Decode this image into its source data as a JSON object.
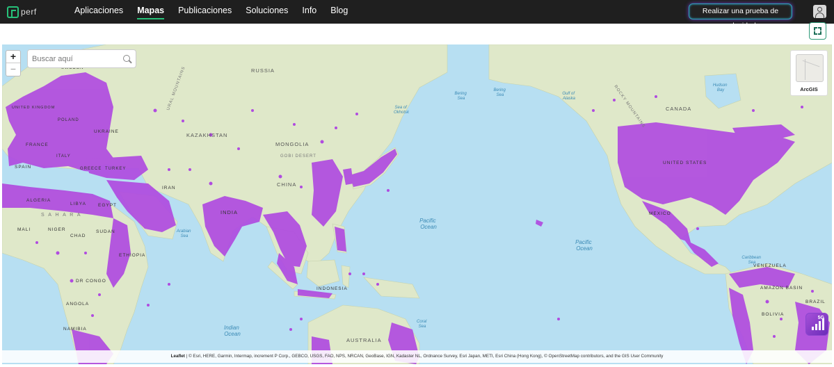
{
  "header": {
    "logo_text": "perf",
    "nav": [
      {
        "label": "Aplicaciones",
        "active": false
      },
      {
        "label": "Mapas",
        "active": true
      },
      {
        "label": "Publicaciones",
        "active": false
      },
      {
        "label": "Soluciones",
        "active": false
      },
      {
        "label": "Info",
        "active": false
      },
      {
        "label": "Blog",
        "active": false
      }
    ],
    "speed_test_label": "Realizar una prueba de velocidad",
    "user_icon": "user-icon",
    "accent_color": "#27c27a"
  },
  "map": {
    "zoom_in": "+",
    "zoom_out": "−",
    "search_placeholder": "Buscar aquí",
    "basemap_label": "ArcGIS",
    "badge_label": "5G",
    "coverage_color": "#b04be0",
    "ocean_color": "#b7dff2",
    "labels": {
      "russia": "RUSSIA",
      "kazakhstan": "KAZAKHSTAN",
      "mongolia": "MONGOLIA",
      "gobi": "GOBI DESERT",
      "china": "CHINA",
      "india": "INDIA",
      "ukraine": "UKRAINE",
      "poland": "POLAND",
      "france": "FRANCE",
      "spain": "SPAIN",
      "italy": "ITALY",
      "greece": "GREECE",
      "turkey": "TURKEY",
      "iran": "IRAN",
      "algeria": "ALGERIA",
      "libya": "LIBYA",
      "egypt": "EGYPT",
      "sahara": "S A H A R A",
      "mali": "MALI",
      "niger": "NIGER",
      "chad": "CHAD",
      "sudan": "SUDAN",
      "ethiopia": "ETHIOPIA",
      "drcongo": "DR CONGO",
      "angola": "ANGOLA",
      "namibia": "NAMIBIA",
      "indonesia": "INDONESIA",
      "australia": "AUSTRALIA",
      "canada": "CANADA",
      "united_states": "UNITED STATES",
      "mexico": "MEXICO",
      "venezuela": "VENEZUELA",
      "amazon": "AMAZON BASIN",
      "bolivia": "BOLIVIA",
      "brazil": "BRAZIL",
      "pacific_ocean": "Pacific\nOcean",
      "indian_ocean": "Indian\nOcean",
      "arabian_sea": "Arabian\nSea",
      "sea_okhotsk": "Sea of\nOkhotsk",
      "bering_sea": "Bering\nSea",
      "gulf_alaska": "Gulf of\nAlaska",
      "hudson_bay": "Hudson\nBay",
      "caribbean": "Caribbean\nSea",
      "coral_sea": "Coral\nSea",
      "rocky": "ROCKY MOUNTAINS",
      "ural": "URAL MOUNTAINS",
      "uk": "UNITED KINGDOM",
      "sweden": "SWEDEN"
    }
  },
  "attribution": {
    "leaflet": "Leaflet",
    "text": " | © Esri, HERE, Garmin, Intermap, increment P Corp., GEBCO, USGS, FAO, NPS, NRCAN, GeoBase, IGN, Kadaster NL, Ordnance Survey, Esri Japan, METI, Esri China (Hong Kong), © OpenStreetMap contributors, and the GIS User Community"
  }
}
